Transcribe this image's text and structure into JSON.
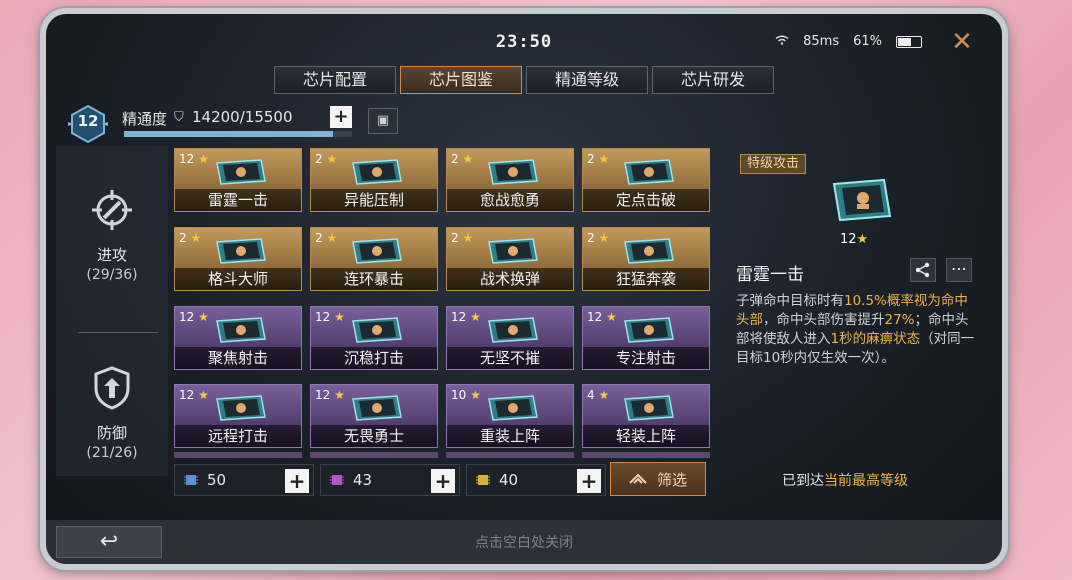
{
  "status": {
    "time": "23:50",
    "latency": "85ms",
    "battery": "61%",
    "battery_level": 0.61
  },
  "tabs": [
    {
      "label": "芯片配置",
      "active": false
    },
    {
      "label": "芯片图鉴",
      "active": true
    },
    {
      "label": "精通等级",
      "active": false
    },
    {
      "label": "芯片研发",
      "active": false
    }
  ],
  "mastery": {
    "level": "12",
    "label": "精通度",
    "value": "14200/15500",
    "progress": 0.916
  },
  "categories": [
    {
      "name": "进攻",
      "count": "(29/36)"
    },
    {
      "name": "防御",
      "count": "(21/26)"
    }
  ],
  "chips": [
    {
      "name": "雷霆一击",
      "stars": "12",
      "rarity": "gold"
    },
    {
      "name": "异能压制",
      "stars": "2",
      "rarity": "gold"
    },
    {
      "name": "愈战愈勇",
      "stars": "2",
      "rarity": "gold"
    },
    {
      "name": "定点击破",
      "stars": "2",
      "rarity": "gold"
    },
    {
      "name": "格斗大师",
      "stars": "2",
      "rarity": "gold"
    },
    {
      "name": "连环暴击",
      "stars": "2",
      "rarity": "gold"
    },
    {
      "name": "战术换弹",
      "stars": "2",
      "rarity": "gold"
    },
    {
      "name": "狂猛奔袭",
      "stars": "2",
      "rarity": "gold"
    },
    {
      "name": "聚焦射击",
      "stars": "12",
      "rarity": "purple"
    },
    {
      "name": "沉稳打击",
      "stars": "12",
      "rarity": "purple"
    },
    {
      "name": "无坚不摧",
      "stars": "12",
      "rarity": "purple"
    },
    {
      "name": "专注射击",
      "stars": "12",
      "rarity": "purple"
    },
    {
      "name": "远程打击",
      "stars": "12",
      "rarity": "purple"
    },
    {
      "name": "无畏勇士",
      "stars": "12",
      "rarity": "purple"
    },
    {
      "name": "重装上阵",
      "stars": "10",
      "rarity": "purple"
    },
    {
      "name": "轻装上阵",
      "stars": "4",
      "rarity": "purple"
    }
  ],
  "resources": [
    {
      "value": "50",
      "color": "#5b8fd6"
    },
    {
      "value": "43",
      "color": "#b356c9"
    },
    {
      "value": "40",
      "color": "#d4b23a"
    }
  ],
  "filter_label": "筛选",
  "detail": {
    "tag": "特级攻击",
    "stars": "12",
    "name": "雷霆一击",
    "desc_parts": [
      {
        "text": "子弹命中目标时有",
        "hl": false
      },
      {
        "text": "10.5%概率视为命中头部",
        "hl": true
      },
      {
        "text": "，命中头部伤害提升",
        "hl": false
      },
      {
        "text": "27%",
        "hl": true
      },
      {
        "text": "；命中头部将使敌人进入",
        "hl": false
      },
      {
        "text": "1秒的麻痹状态",
        "hl": true
      },
      {
        "text": "（对同一目标10秒内仅生效一次）。",
        "hl": false
      }
    ],
    "maxed_prefix": "已到达",
    "maxed_highlight": "当前最高等级"
  },
  "footer": {
    "close_hint": "点击空白处关闭"
  }
}
